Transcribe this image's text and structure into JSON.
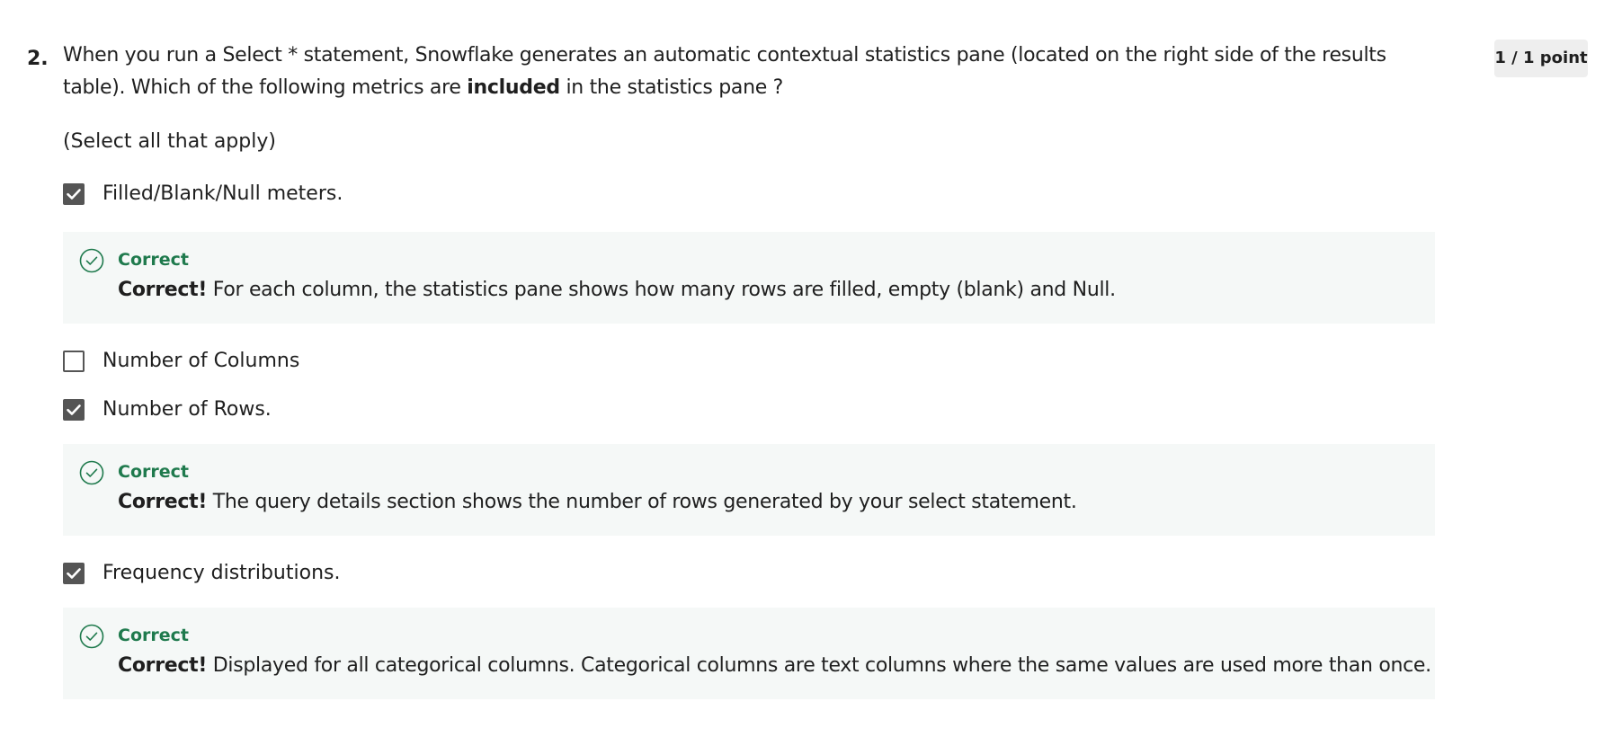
{
  "question": {
    "number": "2.",
    "text_before": "When you run a Select * statement, Snowflake generates an automatic contextual statistics pane (located on the right side of the results table). Which of the following metrics are ",
    "text_bold": "included",
    "text_after": " in the statistics pane ?",
    "points": "1 / 1 point",
    "instruction": "(Select all that apply)"
  },
  "options": [
    {
      "label": "Filled/Blank/Null meters.",
      "checked": true,
      "feedback": {
        "status": "Correct",
        "lead": "Correct!",
        "text": " For each column, the statistics pane shows how many rows are filled, empty (blank) and Null."
      }
    },
    {
      "label": "Number of Columns",
      "checked": false
    },
    {
      "label": "Number of Rows.",
      "checked": true,
      "feedback": {
        "status": "Correct",
        "lead": "Correct!",
        "text": " The query details section shows the number of rows generated by your select statement."
      }
    },
    {
      "label": "Frequency distributions.",
      "checked": true,
      "feedback": {
        "status": "Correct",
        "lead": "Correct!",
        "text": " Displayed for all categorical columns. Categorical columns are text columns where the same values are used more than once."
      }
    }
  ],
  "colors": {
    "correct_green": "#1f7a4d",
    "checkbox_fill": "#555555",
    "feedback_bg": "#f5f8f7",
    "badge_bg": "#eeeeee"
  }
}
